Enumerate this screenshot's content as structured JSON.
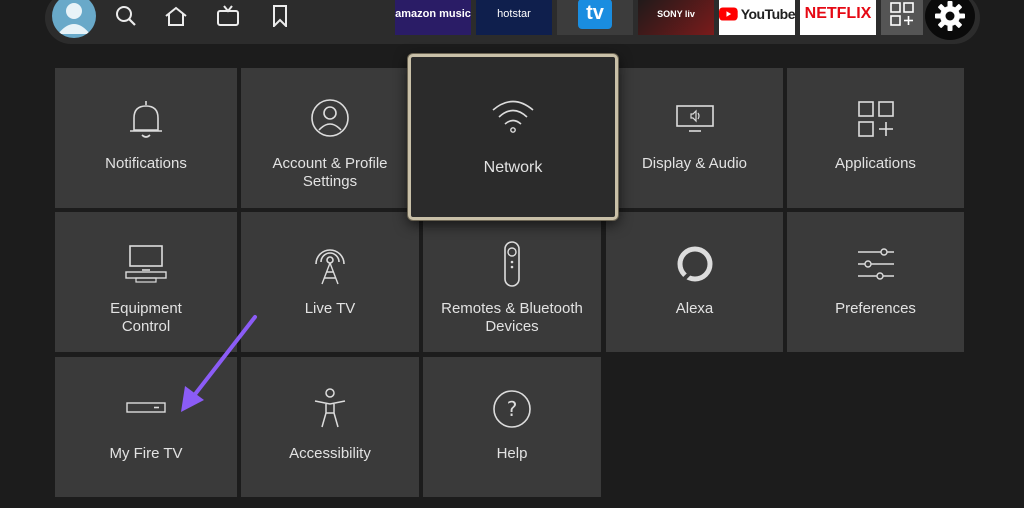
{
  "nav": {
    "icons": [
      "profile-avatar",
      "search-icon",
      "home-icon",
      "live-tv-icon",
      "bookmark-icon"
    ],
    "apps": [
      {
        "name": "amazon-music",
        "label": "amazon music",
        "bg": "#2a1c66",
        "fg": "#ffffff"
      },
      {
        "name": "hotstar",
        "label": "hotstar",
        "bg": "#0f1f4d",
        "fg": "#ffffff"
      },
      {
        "name": "tv",
        "label": "tv",
        "bg": "#1a8de0",
        "fg": "#ffffff"
      },
      {
        "name": "sony-liv",
        "label": "SONY liv",
        "bg": "#1a1a1a",
        "fg": "#ffffff"
      },
      {
        "name": "youtube",
        "label": "YouTube",
        "bg": "#ffffff",
        "fg": "#202020"
      },
      {
        "name": "netflix",
        "label": "NETFLIX",
        "bg": "#ffffff",
        "fg": "#e50914"
      }
    ]
  },
  "tiles": [
    {
      "name": "notifications",
      "label": "Notifications",
      "icon": "bell-icon"
    },
    {
      "name": "account-profile-settings",
      "label": "Account & Profile\nSettings",
      "icon": "profile-icon"
    },
    {
      "name": "network",
      "label": "Network",
      "icon": "wifi-icon",
      "focused": true
    },
    {
      "name": "display-audio",
      "label": "Display & Audio",
      "icon": "display-icon"
    },
    {
      "name": "applications",
      "label": "Applications",
      "icon": "apps-grid-icon"
    },
    {
      "name": "equipment-control",
      "label": "Equipment\nControl",
      "icon": "equipment-icon"
    },
    {
      "name": "live-tv",
      "label": "Live TV",
      "icon": "antenna-icon"
    },
    {
      "name": "remotes-bluetooth",
      "label": "Remotes & Bluetooth\nDevices",
      "icon": "remote-icon"
    },
    {
      "name": "alexa",
      "label": "Alexa",
      "icon": "alexa-icon"
    },
    {
      "name": "preferences",
      "label": "Preferences",
      "icon": "sliders-icon"
    },
    {
      "name": "my-fire-tv",
      "label": "My Fire TV",
      "icon": "fire-tv-device-icon"
    },
    {
      "name": "accessibility",
      "label": "Accessibility",
      "icon": "accessibility-icon"
    },
    {
      "name": "help",
      "label": "Help",
      "icon": "help-icon"
    }
  ],
  "colors": {
    "background": "#1c1c1c",
    "tile": "#3a3a3a",
    "focus_border": "#c9c0a8",
    "annotation_arrow": "#8b5cf6"
  }
}
